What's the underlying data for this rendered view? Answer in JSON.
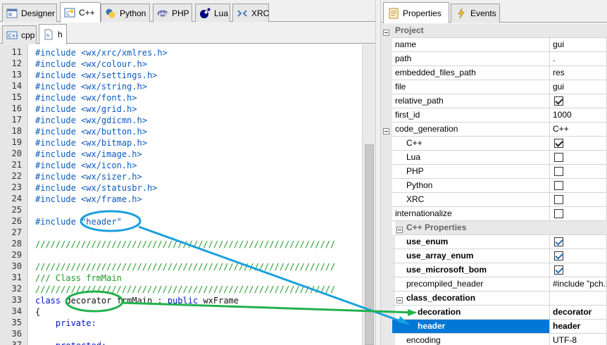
{
  "left": {
    "main_tabs": [
      {
        "label": "Designer",
        "icon": "designer-icon"
      },
      {
        "label": "C++",
        "icon": "cpp-icon"
      },
      {
        "label": "Python",
        "icon": "python-icon"
      },
      {
        "label": "PHP",
        "icon": "php-icon"
      },
      {
        "label": "Lua",
        "icon": "lua-icon"
      },
      {
        "label": "XRC",
        "icon": "xrc-icon"
      }
    ],
    "file_tabs": [
      {
        "label": "cpp",
        "icon": "cpp-file-icon"
      },
      {
        "label": "h",
        "icon": "header-file-icon"
      }
    ],
    "code_lines": [
      {
        "n": "11",
        "parts": [
          [
            "inc",
            "#include <wx/xrc/xmlres.h>"
          ]
        ]
      },
      {
        "n": "12",
        "parts": [
          [
            "inc",
            "#include <wx/colour.h>"
          ]
        ]
      },
      {
        "n": "13",
        "parts": [
          [
            "inc",
            "#include <wx/settings.h>"
          ]
        ]
      },
      {
        "n": "14",
        "parts": [
          [
            "inc",
            "#include <wx/string.h>"
          ]
        ]
      },
      {
        "n": "15",
        "parts": [
          [
            "inc",
            "#include <wx/font.h>"
          ]
        ]
      },
      {
        "n": "16",
        "parts": [
          [
            "inc",
            "#include <wx/grid.h>"
          ]
        ]
      },
      {
        "n": "17",
        "parts": [
          [
            "inc",
            "#include <wx/gdicmn.h>"
          ]
        ]
      },
      {
        "n": "18",
        "parts": [
          [
            "inc",
            "#include <wx/button.h>"
          ]
        ]
      },
      {
        "n": "19",
        "parts": [
          [
            "inc",
            "#include <wx/bitmap.h>"
          ]
        ]
      },
      {
        "n": "20",
        "parts": [
          [
            "inc",
            "#include <wx/image.h>"
          ]
        ]
      },
      {
        "n": "21",
        "parts": [
          [
            "inc",
            "#include <wx/icon.h>"
          ]
        ]
      },
      {
        "n": "22",
        "parts": [
          [
            "inc",
            "#include <wx/sizer.h>"
          ]
        ]
      },
      {
        "n": "23",
        "parts": [
          [
            "inc",
            "#include <wx/statusbr.h>"
          ]
        ]
      },
      {
        "n": "24",
        "parts": [
          [
            "inc",
            "#include <wx/frame.h>"
          ]
        ]
      },
      {
        "n": "25",
        "parts": []
      },
      {
        "n": "26",
        "parts": [
          [
            "inc",
            "#include \"header\""
          ]
        ]
      },
      {
        "n": "27",
        "parts": []
      },
      {
        "n": "28",
        "parts": [
          [
            "cmt",
            "///////////////////////////////////////////////////////////"
          ]
        ]
      },
      {
        "n": "29",
        "parts": []
      },
      {
        "n": "30",
        "parts": [
          [
            "cmt",
            "///////////////////////////////////////////////////////////"
          ]
        ]
      },
      {
        "n": "31",
        "parts": [
          [
            "cmt",
            "/// Class frmMain"
          ]
        ]
      },
      {
        "n": "32",
        "parts": [
          [
            "cmt",
            "///////////////////////////////////////////////////////////"
          ]
        ]
      },
      {
        "n": "33",
        "parts": [
          [
            "kw",
            "class "
          ],
          [
            "tx",
            "decorator frmMain : "
          ],
          [
            "kw",
            "public "
          ],
          [
            "tx",
            "wxFrame"
          ]
        ]
      },
      {
        "n": "34",
        "parts": [
          [
            "tx",
            "{"
          ]
        ]
      },
      {
        "n": "35",
        "parts": [
          [
            "kw",
            "    private:"
          ]
        ]
      },
      {
        "n": "36",
        "parts": []
      },
      {
        "n": "37",
        "parts": [
          [
            "kw",
            "    protected:"
          ]
        ]
      }
    ]
  },
  "right": {
    "tabs": [
      {
        "label": "Properties",
        "icon": "properties-icon"
      },
      {
        "label": "Events",
        "icon": "events-icon"
      }
    ],
    "rows": [
      {
        "kind": "cat",
        "label": "Project",
        "indent": 0
      },
      {
        "kind": "prop",
        "name": "name",
        "value": "gui"
      },
      {
        "kind": "prop",
        "name": "path",
        "value": "."
      },
      {
        "kind": "prop",
        "name": "embedded_files_path",
        "value": "res"
      },
      {
        "kind": "prop",
        "name": "file",
        "value": "gui"
      },
      {
        "kind": "check",
        "name": "relative_path",
        "checked": true
      },
      {
        "kind": "prop",
        "name": "first_id",
        "value": "1000"
      },
      {
        "kind": "group",
        "name": "code_generation",
        "value": "C++"
      },
      {
        "kind": "subcheck",
        "name": "C++",
        "checked": true
      },
      {
        "kind": "subcheck",
        "name": "Lua",
        "checked": false
      },
      {
        "kind": "subcheck",
        "name": "PHP",
        "checked": false
      },
      {
        "kind": "subcheck",
        "name": "Python",
        "checked": false
      },
      {
        "kind": "subcheck",
        "name": "XRC",
        "checked": false
      },
      {
        "kind": "check",
        "name": "internationalize",
        "checked": false
      },
      {
        "kind": "subcat",
        "label": "C++ Properties"
      },
      {
        "kind": "boldcheck",
        "name": "use_enum",
        "checked": true
      },
      {
        "kind": "boldcheck",
        "name": "use_array_enum",
        "checked": true
      },
      {
        "kind": "boldcheck",
        "name": "use_microsoft_bom",
        "checked": true
      },
      {
        "kind": "subprop",
        "name": "precompiled_header",
        "value": "#include \"pch.h\""
      },
      {
        "kind": "subgroup",
        "name": "class_decoration",
        "value": ""
      },
      {
        "kind": "deep",
        "name": "decoration",
        "value": "decorator",
        "selected": false
      },
      {
        "kind": "deep",
        "name": "header",
        "value": "header",
        "selected": true
      },
      {
        "kind": "subprop",
        "name": "encoding",
        "value": "UTF-8"
      }
    ]
  },
  "annotations": {
    "blue": "#1aa0dd",
    "green": "#23b14d"
  }
}
